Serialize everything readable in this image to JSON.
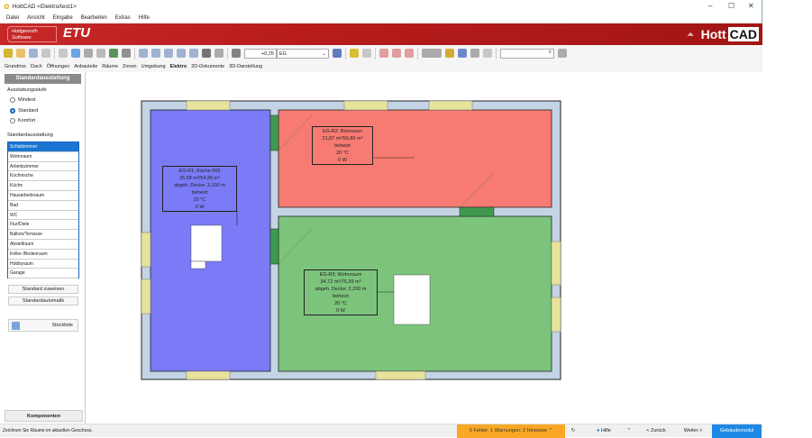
{
  "window": {
    "title": "HottCAD <Elektro/test1>",
    "minimize": "–",
    "maximize": "☐",
    "close": "✕"
  },
  "menu": [
    "Datei",
    "Ansicht",
    "Eingabe",
    "Bearbeiten",
    "Extras",
    "Hilfe"
  ],
  "banner": {
    "logo_line1": "Hottgenroth",
    "logo_line2": "Software",
    "product": "ETU",
    "brand_a": "Hott",
    "brand_b": "CAD"
  },
  "toolbar": {
    "height_value": "+0,25",
    "floor_value": "EG",
    "search_placeholder": ""
  },
  "tabs": [
    "Grundriss",
    "Dach",
    "Öffnungen",
    "Anbauteile",
    "Räume",
    "Zonen",
    "Umgebung",
    "Elektro",
    "2D-Dokumente",
    "3D-Darstellung"
  ],
  "panel": {
    "header": "Standardausstattung",
    "level_label": "Ausstattungsstufe",
    "levels": [
      "Mindest",
      "Standard",
      "Komfort"
    ],
    "selected_level": "Standard",
    "list_label": "Standardausstattung",
    "list": [
      "Schlafzimmer",
      "Wohnraum",
      "Arbeitszimmer",
      "Kochnische",
      "Küche",
      "Hausarbeitsraum",
      "Bad",
      "WC",
      "Flur/Diele",
      "Balkon/Terrasse",
      "Abstellraum",
      "Keller-/Bodenraum",
      "Hobbyraum",
      "Garage"
    ],
    "selected_item": "Schlafzimmer",
    "assign_button": "Standard zuweisen",
    "auto_button": "Standardautomatik",
    "bom_button": "Stückliste",
    "components_button": "Komponenten"
  },
  "rooms": [
    {
      "lines": [
        "EG-R1; Küche 002",
        "25,58 m²/54,36 m³",
        "abgeh. Decke: 2,100 m",
        "beheizt",
        "20 °C",
        "0 W"
      ],
      "color": "#7b7bf7"
    },
    {
      "lines": [
        "EG-R2; Büroraum",
        "21,87 m²/56,86 m³",
        "beheizt",
        "20 °C",
        "0 W"
      ],
      "color": "#f77b73"
    },
    {
      "lines": [
        "EG-R3; Wohnraum",
        "34,72 m²/76,39 m³",
        "abgeh. Decke: 2,200 m",
        "beheizt",
        "20 °C",
        "0 W"
      ],
      "color": "#7cc47c"
    }
  ],
  "status": {
    "hint": "Zeichnen Sie Räume im aktuellen Geschoss.",
    "messages": "0 Fehler; 1 Warnungen; 2 Hinweise",
    "help": "Hilfe",
    "back": "< Zurück",
    "next": "Weiter >",
    "module": "Gebäudemodul"
  }
}
